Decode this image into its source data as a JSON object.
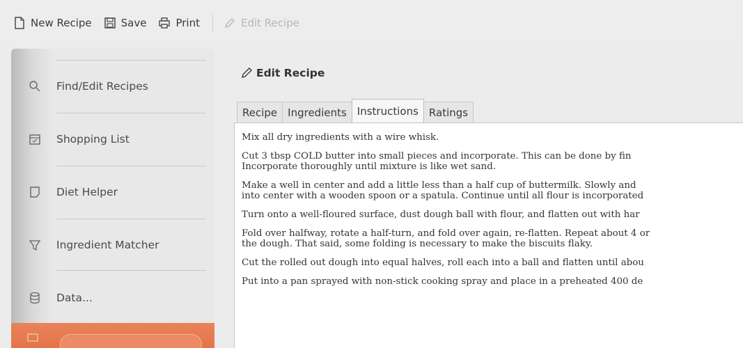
{
  "toolbar": {
    "new_recipe": "New Recipe",
    "save": "Save",
    "print": "Print",
    "edit_recipe": "Edit Recipe"
  },
  "sidebar": {
    "items": [
      {
        "label": "Find/Edit Recipes",
        "icon": "search-icon"
      },
      {
        "label": "Shopping List",
        "icon": "calendar-icon"
      },
      {
        "label": "Diet Helper",
        "icon": "note-icon"
      },
      {
        "label": "Ingredient Matcher",
        "icon": "filter-icon"
      },
      {
        "label": "Data...",
        "icon": "database-icon"
      }
    ],
    "active_accent": "#e47247"
  },
  "main": {
    "title": "Edit Recipe",
    "tabs": [
      "Recipe",
      "Ingredients",
      "Instructions",
      "Ratings"
    ],
    "active_tab": "Instructions",
    "paragraphs": [
      [
        "Mix all dry ingredients with a wire whisk."
      ],
      [
        "Cut 3 tbsp COLD butter into small pieces and incorporate. This can be done by fin",
        "Incorporate thoroughly until mixture is like wet sand."
      ],
      [
        "Make a well in center and add a little less than a half cup of buttermilk. Slowly and",
        "into center with a wooden spoon or a spatula. Continue until all flour is incorporated"
      ],
      [
        "Turn onto a well-floured surface, dust dough ball with flour, and flatten out with har"
      ],
      [
        "Fold over halfway, rotate a half-turn, and fold over again, re-flatten. Repeat about 4 or",
        "the dough. That said, some folding is necessary to make the biscuits flaky."
      ],
      [
        "Cut the rolled out dough into equal halves, roll each into a ball and flatten until abou"
      ],
      [
        "Put into a pan sprayed with non-stick cooking spray and place in a preheated 400 de"
      ]
    ]
  }
}
